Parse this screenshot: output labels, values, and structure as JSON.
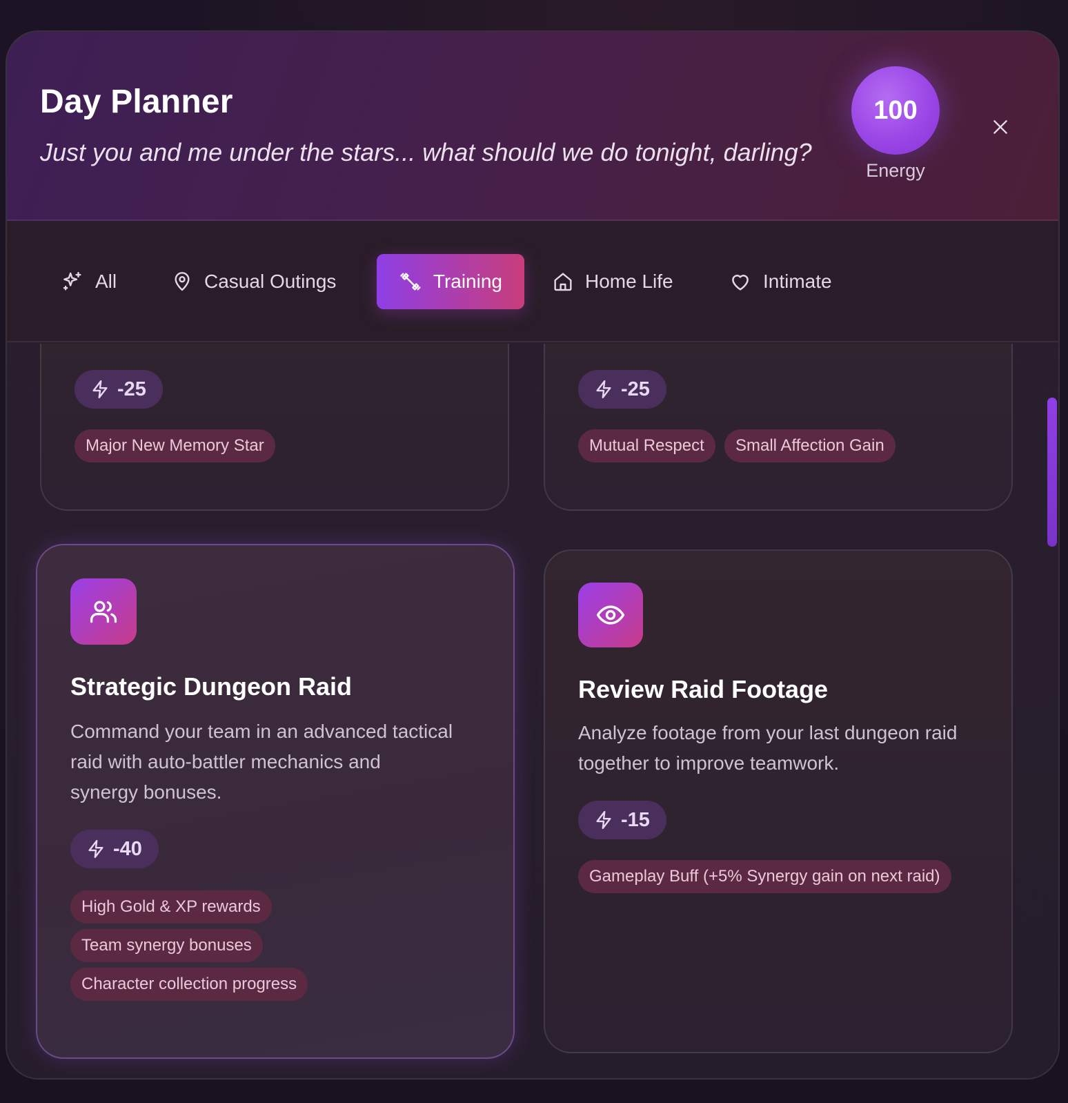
{
  "header": {
    "title": "Day Planner",
    "subtitle": "Just you and me under the stars... what should we do tonight, darling?",
    "energy_value": "100",
    "energy_label": "Energy",
    "close_icon": "close-icon"
  },
  "tabs": [
    {
      "label": "All",
      "icon": "sparkles-icon",
      "active": false
    },
    {
      "label": "Casual Outings",
      "icon": "map-pin-icon",
      "active": false
    },
    {
      "label": "Training",
      "icon": "dumbbell-icon",
      "active": true
    },
    {
      "label": "Home Life",
      "icon": "home-icon",
      "active": false
    },
    {
      "label": "Intimate",
      "icon": "heart-icon",
      "active": false
    }
  ],
  "cards_top": [
    {
      "energy": "-25",
      "tags": [
        "Major New Memory Star"
      ]
    },
    {
      "energy": "-25",
      "tags": [
        "Mutual Respect",
        "Small Affection Gain"
      ]
    }
  ],
  "cards": [
    {
      "icon": "users-icon",
      "title": "Strategic Dungeon Raid",
      "description_lines": [
        "Command your team in an advanced tactical",
        "raid with auto-battler mechanics and",
        "synergy bonuses."
      ],
      "energy": "-40",
      "tags": [
        "High Gold & XP rewards",
        "Team synergy bonuses",
        "Character collection progress"
      ]
    },
    {
      "icon": "eye-icon",
      "title": "Review Raid Footage",
      "description_lines": [
        "Analyze footage from your last dungeon raid",
        "together to improve teamwork."
      ],
      "energy": "-15",
      "tags": [
        "Gameplay Buff (+5% Synergy gain on next raid)"
      ]
    }
  ],
  "colors": {
    "accent_purple": "#8e3fe6",
    "accent_pink": "#c93d7a",
    "tag_bg": "#5b2a42",
    "energy_pill_bg": "#4a2f5c"
  }
}
